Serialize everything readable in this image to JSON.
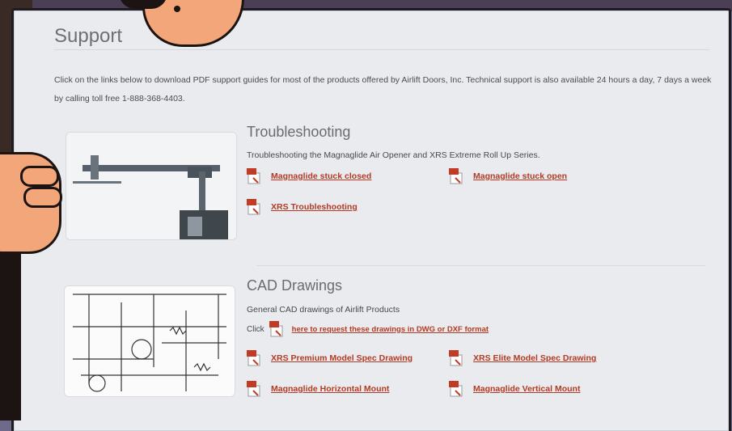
{
  "page": {
    "title": "Support",
    "intro": "Click on the links below to download PDF support guides for most of the products offered by Airlift Doors, Inc. Technical support is also available 24 hours a day, 7 days a week by calling toll free 1-888-368-4403."
  },
  "sections": [
    {
      "title": "Troubleshooting",
      "description": "Troubleshooting the Magnaglide Air Opener and XRS Extreme Roll Up Series.",
      "links": [
        {
          "label": "Magnaglide stuck closed",
          "icon": "pdf-icon"
        },
        {
          "label": "Magnaglide stuck open",
          "icon": "pdf-icon"
        },
        {
          "label": "XRS Troubleshooting",
          "icon": "pdf-icon"
        }
      ]
    },
    {
      "title": "CAD Drawings",
      "description": "General CAD drawings of Airlift Products",
      "click_prefix": "Click",
      "request_link": "here to request these drawings in DWG or DXF format",
      "links": [
        {
          "label": "XRS Premium Model Spec Drawing",
          "icon": "pdf-icon"
        },
        {
          "label": "XRS Elite Model Spec Drawing",
          "icon": "pdf-icon"
        },
        {
          "label": "Magnaglide Horizontal Mount",
          "icon": "pdf-icon"
        },
        {
          "label": "Magnaglide Vertical Mount",
          "icon": "pdf-icon"
        }
      ]
    }
  ],
  "colors": {
    "link": "#b33a24",
    "panel_bg": "#e9ebee",
    "title": "#6d6f75"
  }
}
